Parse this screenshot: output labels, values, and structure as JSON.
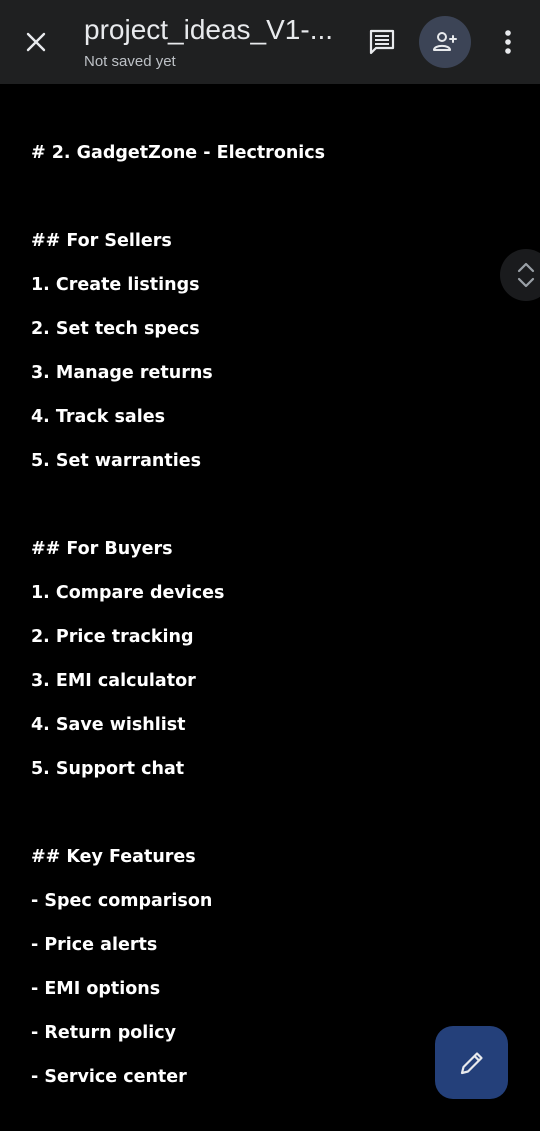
{
  "toolbar": {
    "close_icon": "close-icon",
    "title": "project_ideas_V1-...",
    "status": "Not saved yet",
    "comment_icon": "comment-icon",
    "share_icon": "add-person-icon",
    "more_icon": "more-vert-icon",
    "bar_color": "#1f2021",
    "share_button_color": "#3c4456"
  },
  "document": {
    "lines": [
      "# 2. GadgetZone - Electronics",
      "",
      "## For Sellers",
      "1. Create listings",
      "2. Set tech specs",
      "3. Manage returns",
      "4. Track sales",
      "5. Set warranties",
      "",
      "## For Buyers",
      "1. Compare devices",
      "2. Price tracking",
      "3. EMI calculator",
      "4. Save wishlist",
      "5. Support chat",
      "",
      "## Key Features",
      "- Spec comparison",
      "- Price alerts",
      "- EMI options",
      "- Return policy",
      "- Service center"
    ]
  },
  "scroll_handle": {
    "icon": "scroll-up-down-icon"
  },
  "fab": {
    "icon": "edit-pencil-icon",
    "color": "#24407a"
  }
}
